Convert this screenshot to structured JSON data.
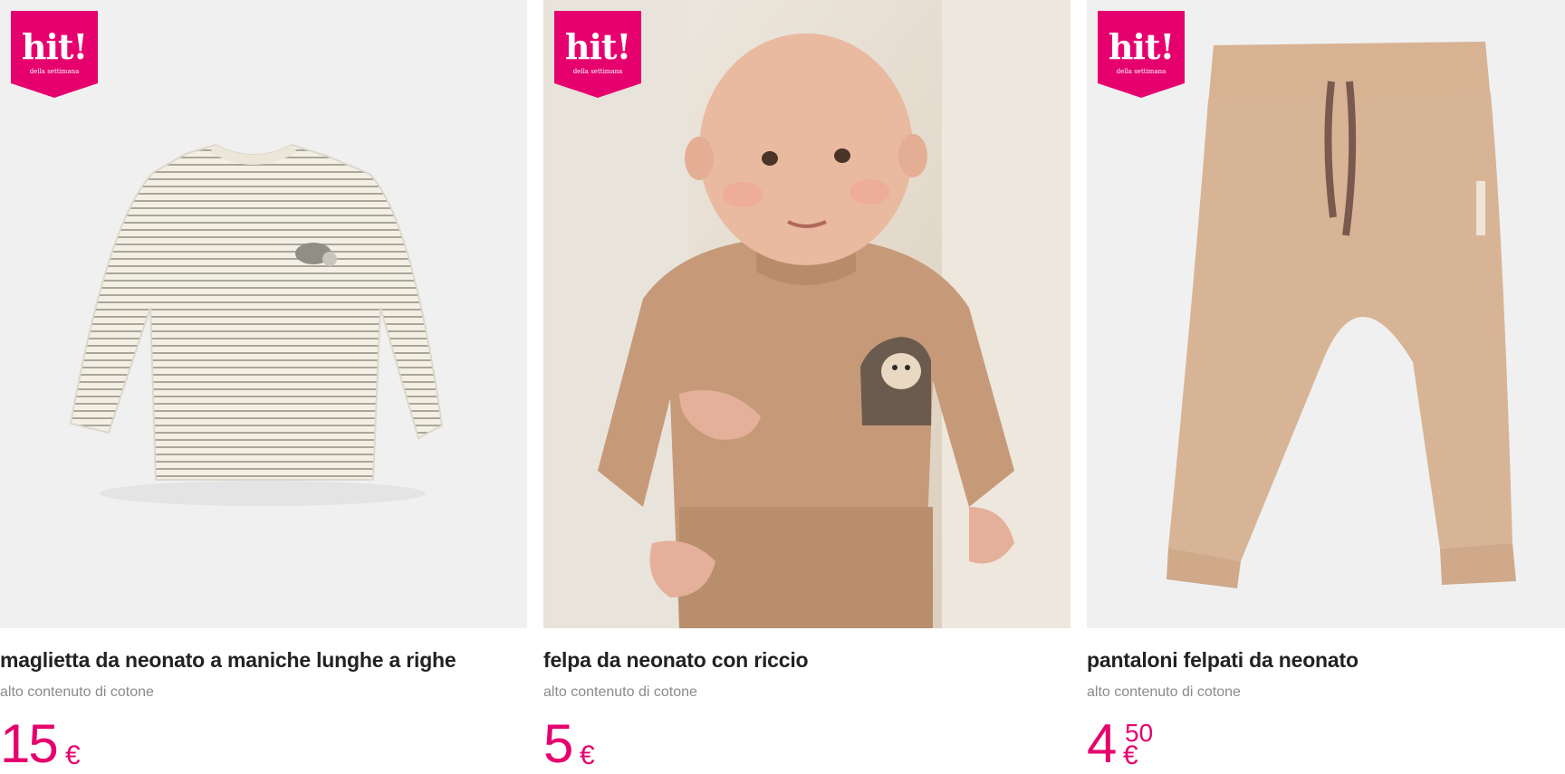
{
  "badge": {
    "text": "hit!",
    "subtext": "della settimana",
    "color": "#e6006e"
  },
  "products": [
    {
      "name": "maglietta da neonato a maniche lunghe a righe",
      "description": "alto contenuto di cotone",
      "price_int": "15",
      "price_dec": "",
      "currency": "€",
      "image": "striped-long-sleeve-shirt"
    },
    {
      "name": "felpa da neonato con riccio",
      "description": "alto contenuto di cotone",
      "price_int": "5",
      "price_dec": "",
      "currency": "€",
      "image": "baby-in-hedgehog-sweatshirt"
    },
    {
      "name": "pantaloni felpati da neonato",
      "description": "alto contenuto di cotone",
      "price_int": "4",
      "price_dec": "50",
      "currency": "€",
      "image": "beige-sweatpants"
    }
  ],
  "colors": {
    "accent": "#e6006e",
    "text": "#222222",
    "muted": "#8a8a8a",
    "image_bg": "#efefef"
  }
}
